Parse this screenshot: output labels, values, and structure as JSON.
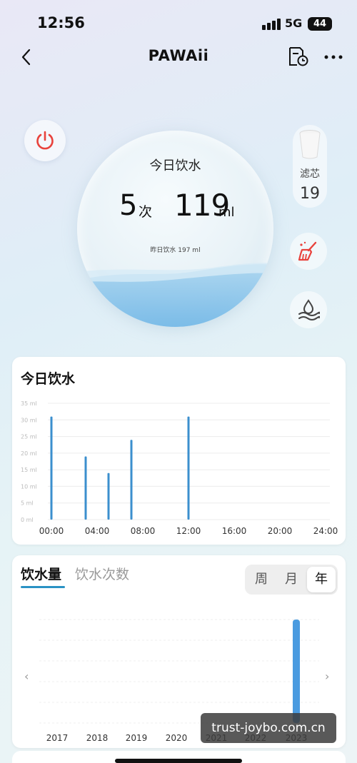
{
  "status_bar": {
    "time": "12:56",
    "network": "5G",
    "battery": "44"
  },
  "nav": {
    "title": "PAWAii"
  },
  "summary": {
    "title": "今日饮水",
    "count": "5",
    "count_unit": "次",
    "volume": "119",
    "volume_unit": "ml",
    "yesterday": "昨日饮水 197 ml"
  },
  "filter": {
    "label": "滤芯",
    "value": "19"
  },
  "icons": {
    "back": "chevron-left-icon",
    "history": "document-clock-icon",
    "more": "more-dots-icon",
    "power": "power-icon",
    "clean": "broom-icon",
    "water": "water-drop-icon",
    "filter": "filter-cup-icon"
  },
  "colors": {
    "accent": "#2a92c4",
    "power": "#e8423c",
    "bar": "#3b8fce",
    "year_bar": "#4a9be0"
  },
  "today_card": {
    "title": "今日饮水"
  },
  "year_card": {
    "tab_amount": "饮水量",
    "tab_count": "饮水次数",
    "segments": {
      "week": "周",
      "month": "月",
      "year": "年"
    },
    "selected": "年"
  },
  "watermark": "trust-joybo.com.cn",
  "chart_data": [
    {
      "type": "bar",
      "title": "今日饮水",
      "x_ticks": [
        "00:00",
        "04:00",
        "08:00",
        "12:00",
        "16:00",
        "20:00",
        "24:00"
      ],
      "y_ticks": [
        "0 ml",
        "5 ml",
        "10 ml",
        "15 ml",
        "20 ml",
        "25 ml",
        "30 ml",
        "35 ml"
      ],
      "ylim": [
        0,
        35
      ],
      "xlim_hours": [
        0,
        24
      ],
      "grid": true,
      "points": [
        {
          "hour": 0.0,
          "value": 31
        },
        {
          "hour": 3.0,
          "value": 19
        },
        {
          "hour": 5.0,
          "value": 14
        },
        {
          "hour": 7.0,
          "value": 24
        },
        {
          "hour": 12.0,
          "value": 31
        }
      ]
    },
    {
      "type": "bar",
      "categories": [
        "2017",
        "2018",
        "2019",
        "2020",
        "2021",
        "2022",
        "2023"
      ],
      "values": [
        0,
        0,
        0,
        0,
        0,
        0,
        100
      ],
      "value_unit": "relative %",
      "grid": true
    }
  ]
}
